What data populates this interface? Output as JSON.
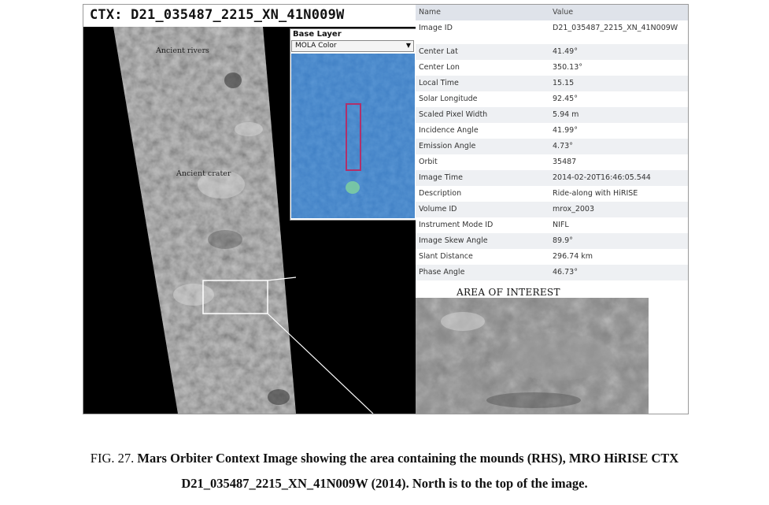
{
  "ctx_title": "CTX: D21_035487_2215_XN_41N009W",
  "strip_labels": {
    "rivers": "Ancient rivers",
    "crater": "Ancient crater"
  },
  "base_layer": {
    "title": "Base Layer",
    "selected": "MOLA Color",
    "arrow_icon": "chevron-down-icon"
  },
  "metadata": {
    "header": {
      "name": "Name",
      "value": "Value"
    },
    "rows": [
      {
        "name": "Image ID",
        "value": "D21_035487_2215_XN_41N009W"
      },
      {
        "name": "Center Lat",
        "value": "41.49°"
      },
      {
        "name": "Center Lon",
        "value": "350.13°"
      },
      {
        "name": "Local Time",
        "value": "15.15"
      },
      {
        "name": "Solar Longitude",
        "value": "92.45°"
      },
      {
        "name": "Scaled Pixel Width",
        "value": "5.94 m"
      },
      {
        "name": "Incidence Angle",
        "value": "41.99°"
      },
      {
        "name": "Emission Angle",
        "value": "4.73°"
      },
      {
        "name": "Orbit",
        "value": "35487"
      },
      {
        "name": "Image Time",
        "value": "2014-02-20T16:46:05.544"
      },
      {
        "name": "Description",
        "value": "Ride-along with HiRISE"
      },
      {
        "name": "Volume ID",
        "value": "mrox_2003"
      },
      {
        "name": "Instrument Mode ID",
        "value": "NIFL"
      },
      {
        "name": "Image Skew Angle",
        "value": "89.9°"
      },
      {
        "name": "Slant Distance",
        "value": "296.74 km"
      },
      {
        "name": "Phase Angle",
        "value": "46.73°"
      }
    ]
  },
  "aoi_label": "AREA OF INTEREST",
  "caption": {
    "prefix": "FIG. 27.",
    "line1": "Mars Orbiter Context Image showing the area containing the mounds (RHS), MRO HiRISE CTX",
    "line2": "D21_035487_2215_XN_41N009W (2014). North is to the top of the image."
  },
  "colors": {
    "map_blue": "#3f7fc4",
    "footprint": "#b0306a",
    "strip_gray": "#8a8a8a"
  }
}
